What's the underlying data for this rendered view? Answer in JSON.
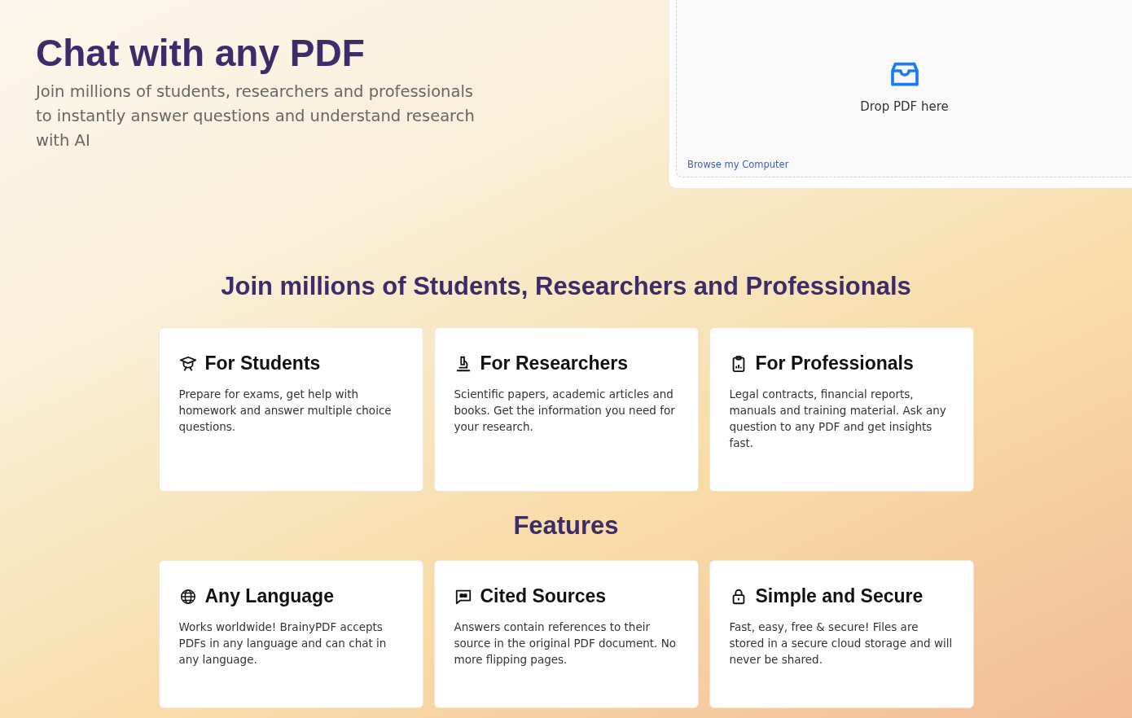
{
  "hero": {
    "title": "Chat with any PDF",
    "subtitle": "Join millions of students, researchers and professionals to instantly answer questions and understand research with AI"
  },
  "upload": {
    "drop_label": "Drop PDF here",
    "browse_link": "Browse my Computer"
  },
  "audiences": {
    "heading": "Join millions of Students, Researchers and Professionals",
    "cards": [
      {
        "kind": "students",
        "title": "For Students",
        "text": "Prepare for exams, get help with homework and answer multiple choice questions."
      },
      {
        "kind": "researchers",
        "title": "For Researchers",
        "text": "Scientific papers, academic articles and books. Get the information you need for your research."
      },
      {
        "kind": "professionals",
        "title": "For Professionals",
        "text": "Legal contracts, financial reports, manuals and training material. Ask any question to any PDF and get insights fast."
      }
    ]
  },
  "features": {
    "heading": "Features",
    "cards": [
      {
        "kind": "language",
        "title": "Any Language",
        "text": "Works worldwide! BrainyPDF accepts PDFs in any language and can chat in any language."
      },
      {
        "kind": "sources",
        "title": "Cited Sources",
        "text": "Answers contain references to their source in the original PDF document. No more flipping pages."
      },
      {
        "kind": "security",
        "title": "Simple and Secure",
        "text": "Fast, easy, free & secure! Files are stored in a secure cloud storage and will never be shared."
      }
    ]
  }
}
